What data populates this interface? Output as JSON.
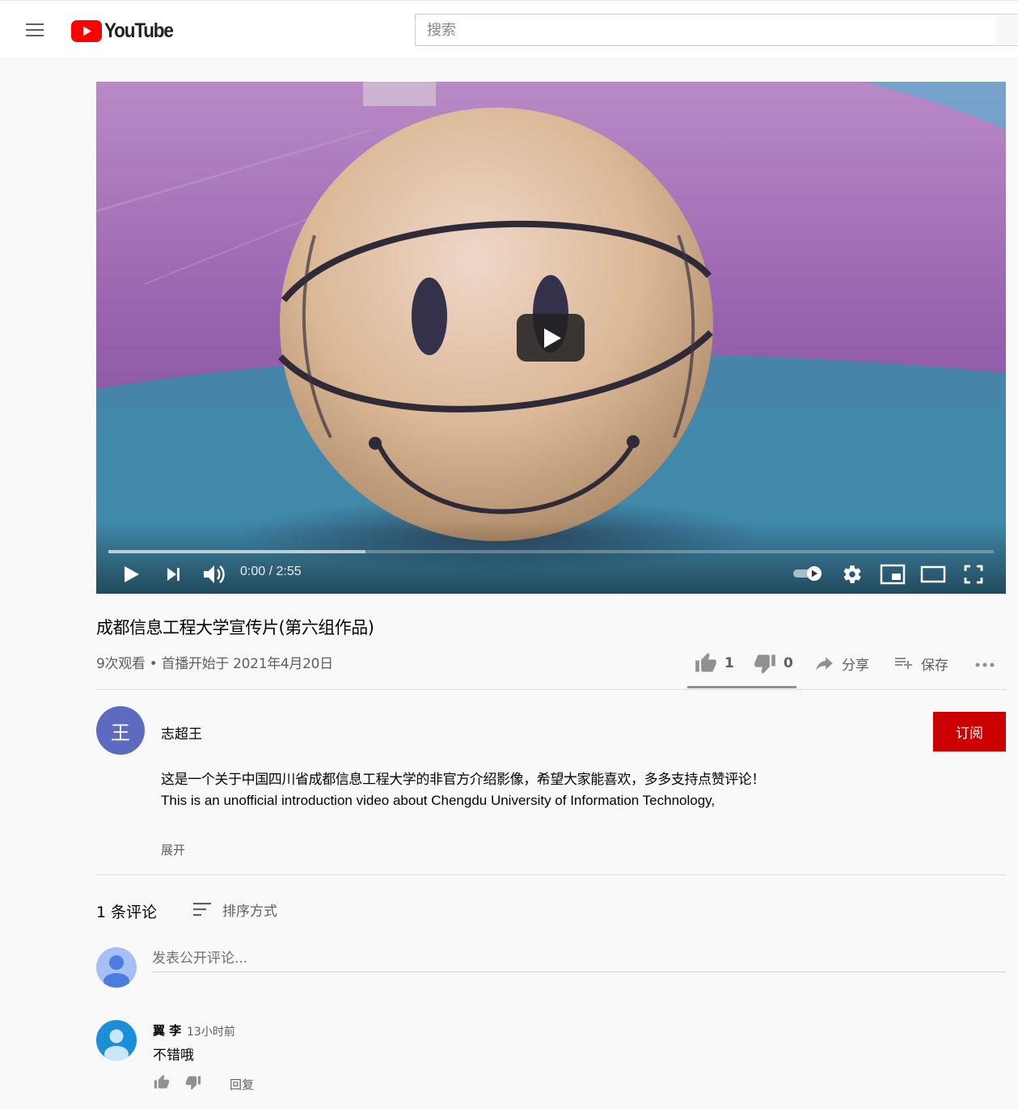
{
  "header": {
    "menu_icon": "hamburger-menu-icon",
    "logo_text": "YouTube",
    "search_placeholder": "搜索"
  },
  "player": {
    "current_time": "0:00",
    "duration": "2:55",
    "time_text": "0:00 / 2:55",
    "loaded_fraction": 0.29,
    "icons": [
      "play-icon",
      "next-icon",
      "volume-icon",
      "autoplay-toggle-icon",
      "settings-gear-icon",
      "miniplayer-icon",
      "theater-mode-icon",
      "fullscreen-icon"
    ]
  },
  "video": {
    "title": "成都信息工程大学宣传片(第六组作品)",
    "view_info": "9次观看 • 首播开始于 2021年4月20日",
    "likes": "1",
    "dislikes": "0",
    "share_label": "分享",
    "save_label": "保存"
  },
  "channel": {
    "avatar_letter": "王",
    "name": "志超王",
    "subscribe_label": "订阅"
  },
  "description": {
    "line_zh": "这是一个关于中国四川省成都信息工程大学的非官方介绍影像，希望大家能喜欢，多多支持点赞评论！",
    "line_en": "This is an unofficial introduction video about Chengdu University of Information Technology,",
    "show_more": "展开"
  },
  "comments": {
    "count_label": "1 条评论",
    "sort_label": "排序方式",
    "input_placeholder": "发表公开评论...",
    "items": [
      {
        "author": "翼 李",
        "time": "13小时前",
        "text": "不错哦",
        "reply_label": "回复"
      }
    ]
  },
  "colors": {
    "brand_red": "#ff0000",
    "subscribe_red": "#cc0000",
    "channel_avatar": "#5c6bc0"
  }
}
